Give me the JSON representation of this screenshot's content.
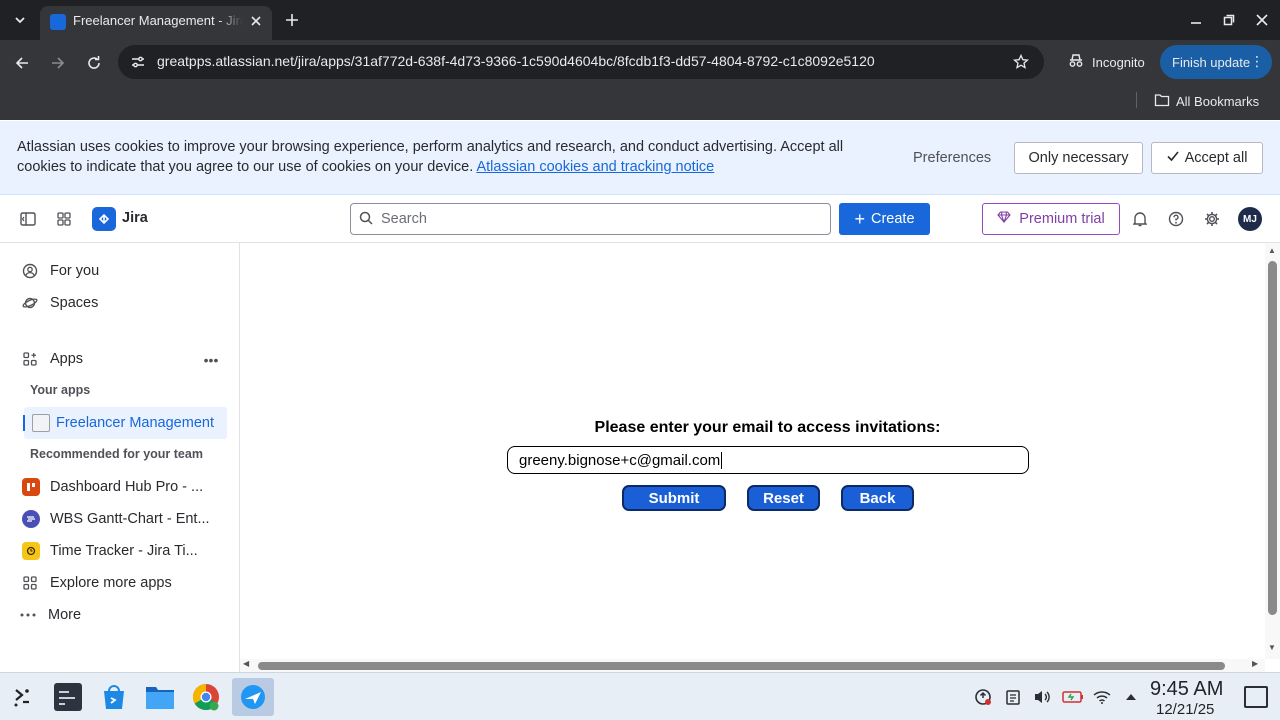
{
  "browser": {
    "tab_title": "Freelancer Management - Jira",
    "url": "greatpps.atlassian.net/jira/apps/31af772d-638f-4d73-9366-1c590d4604bc/8fcdb1f3-dd57-4804-8792-c1c8092e5120",
    "incognito_label": "Incognito",
    "finish_update_label": "Finish update",
    "all_bookmarks_label": "All Bookmarks"
  },
  "cookie_banner": {
    "text": "Atlassian uses cookies to improve your browsing experience, perform analytics and research, and conduct advertising. Accept all cookies to indicate that you agree to our use of cookies on your device.",
    "link_text": "Atlassian cookies and tracking notice",
    "preferences_label": "Preferences",
    "only_necessary_label": "Only necessary",
    "accept_all_label": "Accept all"
  },
  "jira_nav": {
    "product_name": "Jira",
    "search_placeholder": "Search",
    "create_label": "Create",
    "premium_label": "Premium trial",
    "avatar_initials": "MJ",
    "brand_color": "#1868db",
    "premium_color": "#803fa5"
  },
  "sidebar": {
    "for_you": "For you",
    "spaces": "Spaces",
    "apps": "Apps",
    "your_apps_heading": "Your apps",
    "selected_app": "Freelancer Management",
    "recommended_heading": "Recommended for your team",
    "recommended": [
      {
        "label": "Dashboard Hub Pro - ...",
        "icon": "dashboard-hub-icon",
        "color": "#d9480f"
      },
      {
        "label": "WBS Gantt-Chart - Ent...",
        "icon": "wbs-gantt-icon",
        "color": "#4a4fb5"
      },
      {
        "label": "Time Tracker - Jira Ti...",
        "icon": "time-tracker-icon",
        "color": "#f5c518"
      }
    ],
    "explore_more": "Explore more apps",
    "more": "More"
  },
  "form": {
    "prompt": "Please enter your email to access invitations:",
    "email_value": "greeny.bignose+c@gmail.com",
    "submit_label": "Submit",
    "reset_label": "Reset",
    "back_label": "Back",
    "button_color": "#1a5fd6"
  },
  "taskbar": {
    "time": "9:45 AM",
    "date": "12/21/25"
  }
}
